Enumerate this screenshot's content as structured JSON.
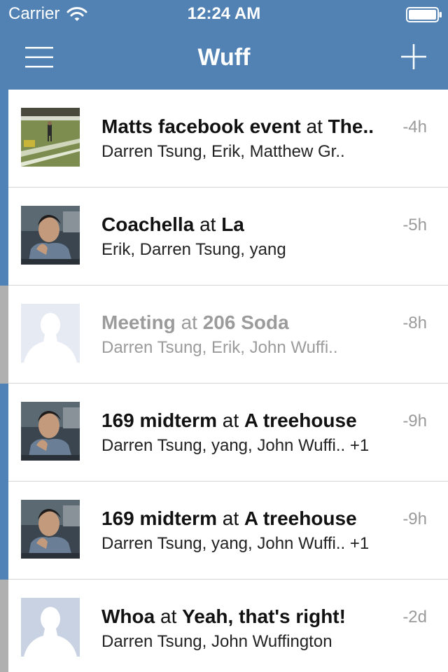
{
  "status_bar": {
    "carrier": "Carrier",
    "time": "12:24 AM",
    "icons": [
      "wifi-icon",
      "battery-icon"
    ]
  },
  "nav": {
    "title": "Wuff",
    "left_icon": "hamburger-menu-icon",
    "right_icon": "plus-icon"
  },
  "colors": {
    "nav_background": "#5182b3",
    "indicator_active": "#4f82b6",
    "indicator_inactive": "#b0b0b0",
    "time_text": "#9a9a9a"
  },
  "events": [
    {
      "name": "Matts facebook event",
      "connector": "at",
      "place": "The..",
      "people": "Darren Tsung, Erik, Matthew Gr..",
      "time": "-4h",
      "thumbnail": "field-photo",
      "active": true,
      "dimmed": false
    },
    {
      "name": "Coachella",
      "connector": "at",
      "place": "La",
      "people": "Erik, Darren Tsung, yang",
      "time": "-5h",
      "thumbnail": "person-photo",
      "active": true,
      "dimmed": false
    },
    {
      "name": "Meeting",
      "connector": "at",
      "place": "206 Soda",
      "people": "Darren Tsung, Erik, John Wuffi..",
      "time": "-8h",
      "thumbnail": "default-avatar-light",
      "active": false,
      "dimmed": true
    },
    {
      "name": "169 midterm",
      "connector": "at",
      "place": "A treehouse",
      "people": "Darren Tsung, yang, John Wuffi.. +1",
      "time": "-9h",
      "thumbnail": "person-photo",
      "active": true,
      "dimmed": false
    },
    {
      "name": "169 midterm",
      "connector": "at",
      "place": "A treehouse",
      "people": "Darren Tsung, yang, John Wuffi.. +1",
      "time": "-9h",
      "thumbnail": "person-photo",
      "active": true,
      "dimmed": false
    },
    {
      "name": "Whoa",
      "connector": "at",
      "place": "Yeah, that's right!",
      "people": "Darren Tsung, John Wuffington",
      "time": "-2d",
      "thumbnail": "default-avatar",
      "active": false,
      "dimmed": false
    }
  ]
}
